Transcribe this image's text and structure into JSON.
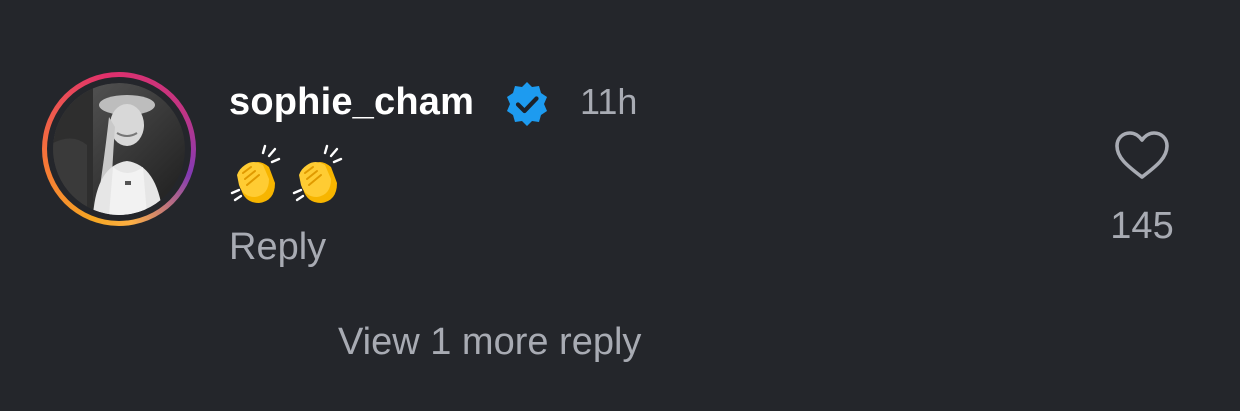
{
  "comment": {
    "username": "sophie_cham",
    "verified": true,
    "verified_badge_color": "#1d9bf0",
    "timestamp": "11h",
    "text": "👏👏",
    "reply_label": "Reply",
    "like_icon": "heart-outline-icon",
    "like_count": "145",
    "avatar_ring_colors": [
      "#f5a623",
      "#e1306c",
      "#c13584",
      "#833ab4"
    ]
  },
  "replies": {
    "view_more_label": "View 1 more reply"
  },
  "theme": {
    "background": "#24262b",
    "primary_text": "#ffffff",
    "secondary_text": "#a8abb3"
  }
}
